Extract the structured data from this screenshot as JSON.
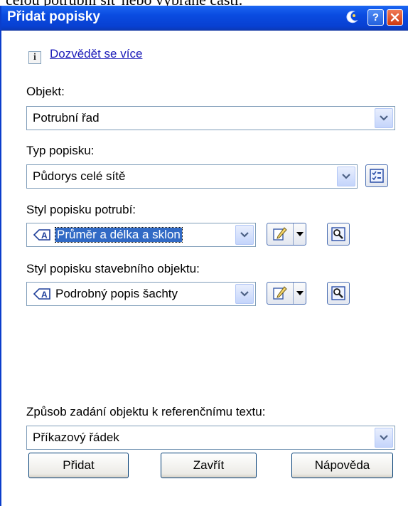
{
  "top_text": "celou potrubní síť nebo vybrané části.",
  "window": {
    "title": "Přidat popisky"
  },
  "titlebar_icons": {
    "pin": "pin-icon",
    "help": "help-icon",
    "close": "close-icon",
    "help_glyph": "?"
  },
  "info": {
    "icon_glyph": "i",
    "link_text": "Dozvědět se více"
  },
  "object": {
    "label": "Objekt:",
    "value": "Potrubní řad"
  },
  "label_type": {
    "label": "Typ popisku:",
    "value": "Půdorys celé sítě"
  },
  "pipe_style": {
    "label": "Styl popisku potrubí:",
    "value": "Průměr a délka a sklon"
  },
  "structure_style": {
    "label": "Styl popisku stavebního objektu:",
    "value": "Podrobný popis šachty"
  },
  "reference": {
    "label": "Způsob zadání objektu k referenčnímu textu:",
    "value": "Příkazový řádek"
  },
  "buttons": {
    "add": "Přidat",
    "close": "Zavřít",
    "help": "Nápověda"
  },
  "colors": {
    "title_bar": "#0a4be0",
    "link": "#1a1ab8",
    "selection": "#316ac5"
  }
}
